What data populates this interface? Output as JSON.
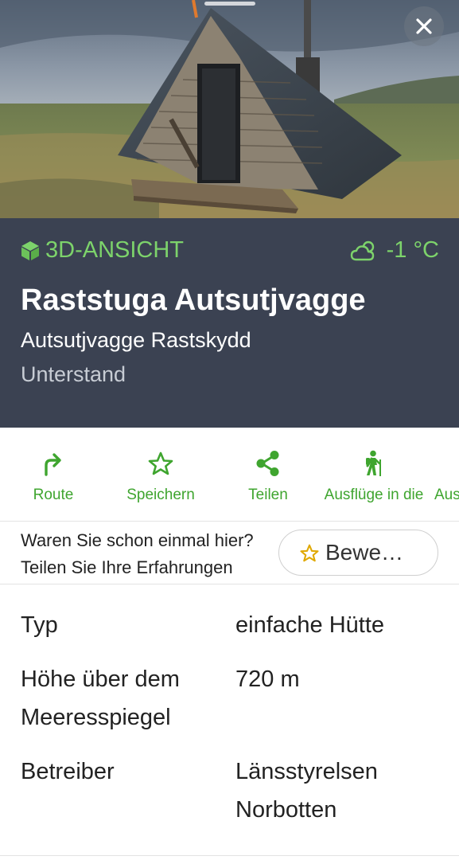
{
  "hero": {
    "image_description_icon": "photo-a-frame-hut",
    "close_icon": "close-icon"
  },
  "header": {
    "view3d_label": "3D-ANSICHT",
    "weather_icon": "cloud-sun-icon",
    "temperature": "-1 °C",
    "title": "Raststuga Autsutjvagge",
    "subtitle": "Autsutjvagge Rastskydd",
    "category": "Unterstand"
  },
  "actions": [
    {
      "label": "Route",
      "icon": "route-arrow-icon"
    },
    {
      "label": "Speichern",
      "icon": "star-icon"
    },
    {
      "label": "Teilen",
      "icon": "share-icon"
    },
    {
      "label": "Ausflüge in die",
      "icon": "hiker-icon"
    },
    {
      "label": "Aus",
      "icon": ""
    }
  ],
  "review": {
    "question": "Waren Sie schon einmal hier?",
    "prompt": "Teilen Sie Ihre Erfahrungen",
    "button_label": "Bewe…"
  },
  "details": [
    {
      "key": "Typ",
      "value": "einfache Hütte"
    },
    {
      "key": "Höhe über dem Meeresspiegel",
      "value": "720 m"
    },
    {
      "key": "Betreiber",
      "value": "Länsstyrelsen Norbotten"
    }
  ],
  "colors": {
    "accent_green": "#3fa52f",
    "header_green": "#7dd36b",
    "header_bg": "#3b4252"
  }
}
